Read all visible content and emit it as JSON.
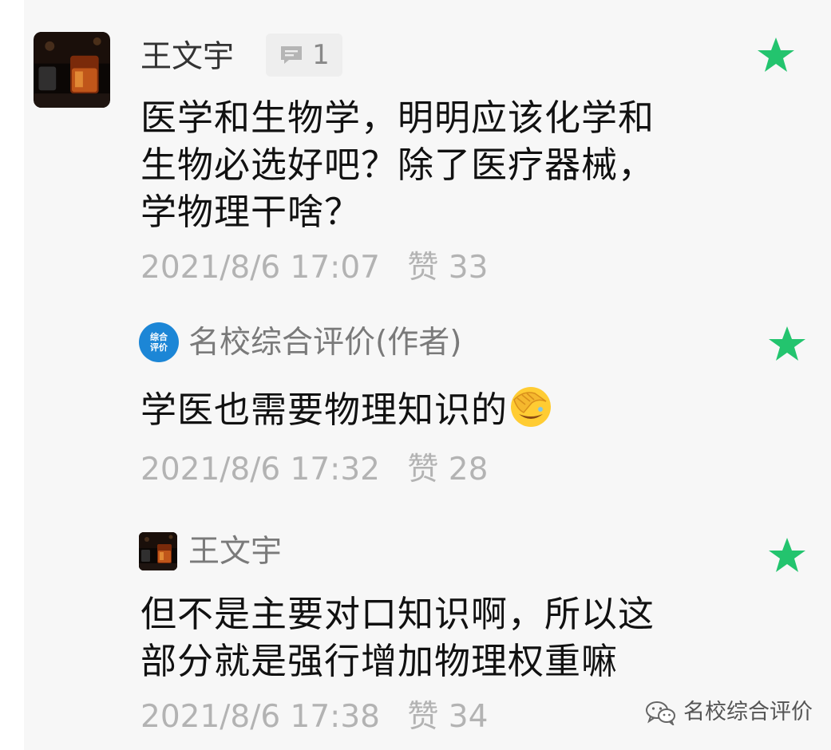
{
  "comment": {
    "author": "王文宇",
    "reply_count": "1",
    "text_lines": [
      "医学和生物学，明明应该化学和",
      "生物必选好吧？除了医疗器械，",
      "学物理干啥？"
    ],
    "time": "2021/8/6 17:07",
    "likes": "赞 33",
    "starred": true
  },
  "replies": [
    {
      "author": "名校综合评价(作者)",
      "logo_text": [
        "综合",
        "评价"
      ],
      "text": "学医也需要物理知识的",
      "emoji": "face-with-hand-over-eyes",
      "time": "2021/8/6 17:32",
      "likes": "赞 28",
      "starred": true
    },
    {
      "author": "王文宇",
      "text_lines": [
        "但不是主要对口知识啊，所以这",
        "部分就是强行增加物理权重嘛"
      ],
      "time": "2021/8/6 17:38",
      "likes": "赞 34",
      "starred": true
    }
  ],
  "watermark": {
    "icon": "wechat-icon",
    "label": "名校综合评价"
  },
  "colors": {
    "star": "#23c46e",
    "card_bg": "#f7f7f7",
    "meta_text": "#b3b3b3",
    "logo_blue": "#1c86d6"
  }
}
